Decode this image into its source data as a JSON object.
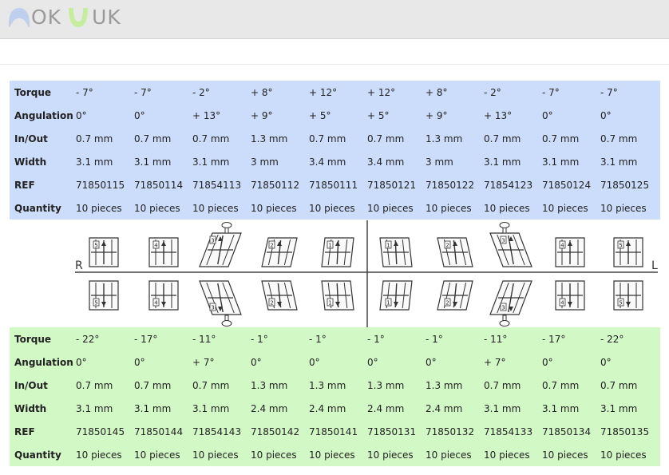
{
  "header": {
    "logo_text_left": "OK",
    "logo_text_right": "UK",
    "logo_colors": {
      "left_tooth": "#bfd0ee",
      "right_tooth": "#c4ee9c",
      "text": "#9a9a9a"
    }
  },
  "colors": {
    "upper_bg": "#ccdcfb",
    "lower_bg": "#d2f8c6"
  },
  "diagram": {
    "side_left": "R",
    "side_right": "L",
    "upper_numbers": [
      "5",
      "4",
      "3",
      "2",
      "1",
      "1",
      "2",
      "3",
      "4",
      "5"
    ],
    "lower_numbers": [
      "5",
      "4",
      "3",
      "2",
      "1",
      "1",
      "2",
      "3",
      "4",
      "5"
    ]
  },
  "upper": {
    "rows": [
      {
        "label": "Torque",
        "values": [
          "- 7°",
          "- 7°",
          "- 2°",
          "+ 8°",
          "+ 12°",
          "+ 12°",
          "+ 8°",
          "- 2°",
          "- 7°",
          "- 7°"
        ]
      },
      {
        "label": "Angulation",
        "values": [
          "0°",
          "0°",
          "+ 13°",
          "+ 9°",
          "+ 5°",
          "+ 5°",
          "+ 9°",
          "+ 13°",
          "0°",
          "0°"
        ]
      },
      {
        "label": "In/Out",
        "values": [
          "0.7 mm",
          "0.7 mm",
          "0.7 mm",
          "1.3 mm",
          "0.7 mm",
          "0.7 mm",
          "1.3 mm",
          "0.7 mm",
          "0.7 mm",
          "0.7 mm"
        ]
      },
      {
        "label": "Width",
        "values": [
          "3.1 mm",
          "3.1 mm",
          "3.1 mm",
          "3 mm",
          "3.4 mm",
          "3.4 mm",
          "3 mm",
          "3.1 mm",
          "3.1 mm",
          "3.1 mm"
        ]
      },
      {
        "label": "REF",
        "values": [
          "71850115",
          "71850114",
          "71854113",
          "71850112",
          "71850111",
          "71850121",
          "71850122",
          "71854123",
          "71850124",
          "71850125"
        ]
      },
      {
        "label": "Quantity",
        "values": [
          "10 pieces",
          "10 pieces",
          "10 pieces",
          "10 pieces",
          "10 pieces",
          "10 pieces",
          "10 pieces",
          "10 pieces",
          "10 pieces",
          "10 pieces"
        ]
      }
    ]
  },
  "lower": {
    "rows": [
      {
        "label": "Torque",
        "values": [
          "- 22°",
          "- 17°",
          "- 11°",
          "- 1°",
          "- 1°",
          "- 1°",
          "- 1°",
          "- 11°",
          "- 17°",
          "- 22°"
        ]
      },
      {
        "label": "Angulation",
        "values": [
          "0°",
          "0°",
          "+ 7°",
          "0°",
          "0°",
          "0°",
          "0°",
          "+ 7°",
          "0°",
          "0°"
        ]
      },
      {
        "label": "In/Out",
        "values": [
          "0.7 mm",
          "0.7 mm",
          "0.7 mm",
          "1.3 mm",
          "1.3 mm",
          "1.3 mm",
          "1.3 mm",
          "0.7 mm",
          "0.7 mm",
          "0.7 mm"
        ]
      },
      {
        "label": "Width",
        "values": [
          "3.1 mm",
          "3.1 mm",
          "3.1 mm",
          "2.4 mm",
          "2.4 mm",
          "2.4 mm",
          "2.4 mm",
          "3.1 mm",
          "3.1 mm",
          "3.1 mm"
        ]
      },
      {
        "label": "REF",
        "values": [
          "71850145",
          "71850144",
          "71854143",
          "71850142",
          "71850141",
          "71850131",
          "71850132",
          "71854133",
          "71850134",
          "71850135"
        ]
      },
      {
        "label": "Quantity",
        "values": [
          "10 pieces",
          "10 pieces",
          "10 pieces",
          "10 pieces",
          "10 pieces",
          "10 pieces",
          "10 pieces",
          "10 pieces",
          "10 pieces",
          "10 pieces"
        ]
      }
    ]
  }
}
